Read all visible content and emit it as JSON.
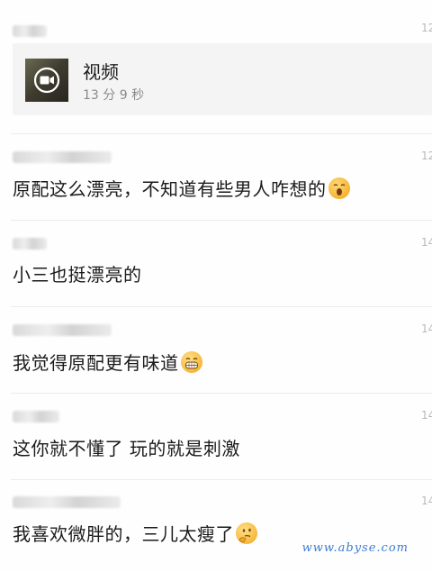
{
  "top_comment": {
    "time_fragment": "12"
  },
  "video": {
    "title": "视频",
    "duration": "13 分 9 秒",
    "play_icon": "video-camera-icon"
  },
  "comments": [
    {
      "text": "原配这么漂亮，不知道有些男人咋想的",
      "emoji": "surprised-face-emoji",
      "time_fragment": "12"
    },
    {
      "text": "小三也挺漂亮的",
      "emoji": "",
      "time_fragment": "14"
    },
    {
      "text": "我觉得原配更有味道",
      "emoji": "grinning-face-emoji",
      "time_fragment": "14"
    },
    {
      "text": "这你就不懂了 玩的就是刺激",
      "emoji": "",
      "time_fragment": "14"
    },
    {
      "text": "我喜欢微胖的，三儿太瘦了",
      "emoji": "thinking-face-emoji",
      "time_fragment": "14"
    }
  ],
  "watermark": "www.abyse.com"
}
